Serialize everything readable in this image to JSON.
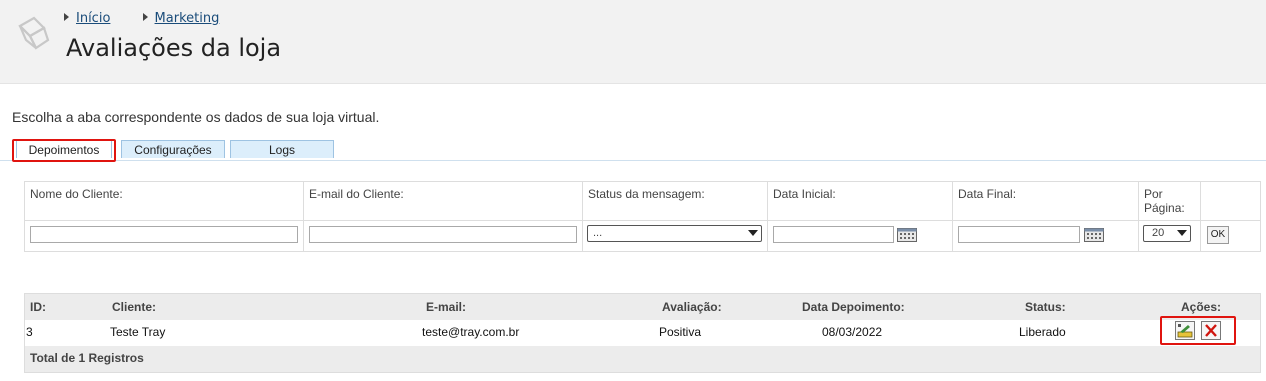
{
  "breadcrumb": [
    {
      "label": "Início"
    },
    {
      "label": "Marketing"
    }
  ],
  "page_title": "Avaliações da loja",
  "intro": "Escolha a aba correspondente os dados de sua loja virtual.",
  "tabs": [
    {
      "label": "Depoimentos",
      "active": true
    },
    {
      "label": "Configurações",
      "active": false
    },
    {
      "label": "Logs",
      "active": false
    }
  ],
  "filters": {
    "nome_label": "Nome do Cliente:",
    "email_label": "E-mail do Cliente:",
    "status_label": "Status da mensagem:",
    "status_value": "...",
    "data_inicial_label": "Data Inicial:",
    "data_final_label": "Data Final:",
    "por_pagina_label_1": "Por",
    "por_pagina_label_2": "Página:",
    "por_pagina_value": "20",
    "ok_label": "OK"
  },
  "table": {
    "headers": [
      "ID:",
      "Cliente:",
      "E-mail:",
      "Avaliação:",
      "Data Depoimento:",
      "Status:",
      "Ações:"
    ],
    "rows": [
      {
        "id": "3",
        "cliente": "Teste Tray",
        "email": "teste@tray.com.br",
        "avaliacao": "Positiva",
        "data": "08/03/2022",
        "status": "Liberado"
      }
    ],
    "footer": "Total de 1 Registros"
  },
  "colors": {
    "highlight": "#e0140f",
    "tab_bg": "#dceefb",
    "link": "#1a4c7a"
  },
  "icons": {
    "logo": "box-outline-icon",
    "calendar": "calendar-icon",
    "edit": "edit-icon",
    "delete": "delete-icon"
  }
}
